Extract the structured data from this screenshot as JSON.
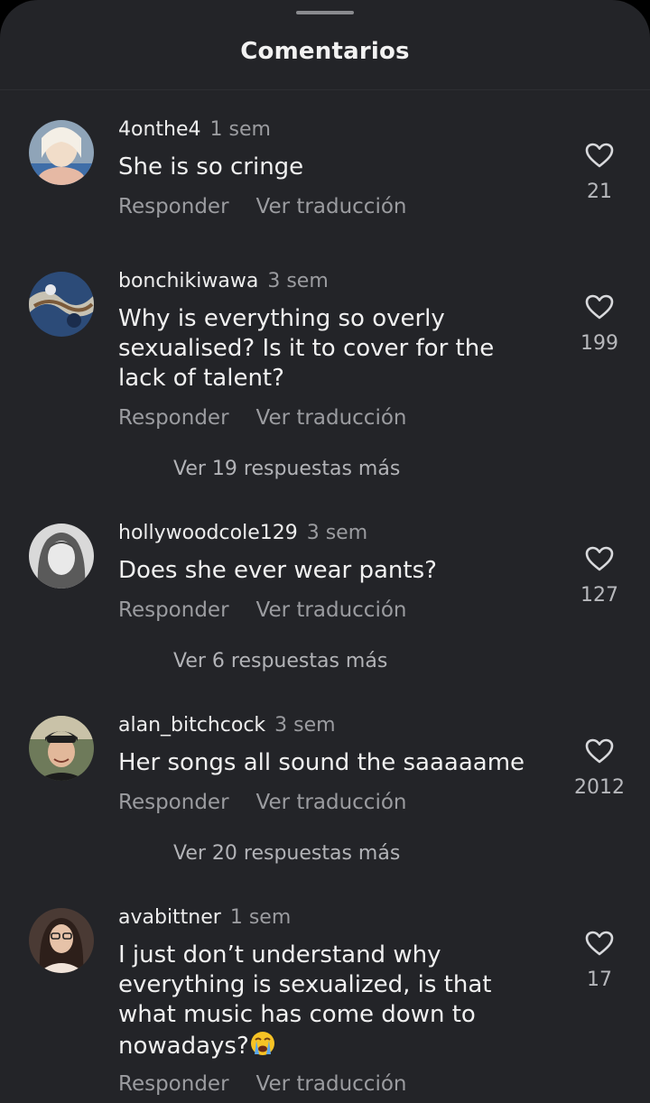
{
  "header": {
    "title": "Comentarios"
  },
  "actions": {
    "reply": "Responder",
    "translate": "Ver traducción"
  },
  "comments": [
    {
      "username": "4onthe4",
      "time": "1 sem",
      "lines": [
        "She is so cringe"
      ],
      "likes": "21",
      "more_replies": ""
    },
    {
      "username": "bonchikiwawa",
      "time": "3 sem",
      "lines": [
        "Why is everything so overly",
        "sexualised? Is it to cover for the",
        "lack of talent?"
      ],
      "likes": "199",
      "more_replies": "Ver 19 respuestas más"
    },
    {
      "username": "hollywoodcole129",
      "time": "3 sem",
      "lines": [
        "Does she ever wear pants?"
      ],
      "likes": "127",
      "more_replies": "Ver 6 respuestas más"
    },
    {
      "username": "alan_bitchcock",
      "time": "3 sem",
      "lines": [
        "Her songs all sound the saaaaame"
      ],
      "likes": "2012",
      "more_replies": "Ver 20 respuestas más"
    },
    {
      "username": "avabittner",
      "time": "1 sem",
      "lines": [
        "I just don’t understand why",
        "everything is sexualized, is that",
        "what music has come down to",
        "nowadays?"
      ],
      "trailing_emoji": "loudly-crying-face-emoji",
      "likes": "17",
      "more_replies": ""
    }
  ],
  "colors": {
    "background": "#232428",
    "text": "#f0f0f0",
    "muted": "#9b9ca0"
  }
}
